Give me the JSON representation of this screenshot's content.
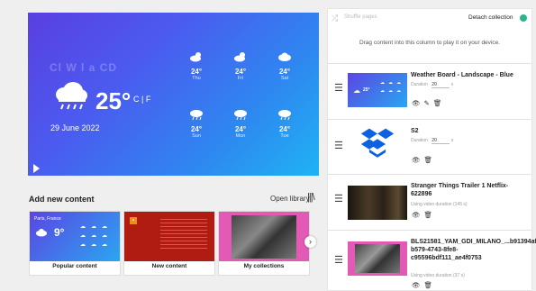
{
  "preview": {
    "faded_title": "Cl W  l  a  CD",
    "temperature": "25°",
    "unit_toggle": "C | F",
    "date": "29 June 2022",
    "forecast": [
      {
        "temp": "24°",
        "day": "Thu"
      },
      {
        "temp": "24°",
        "day": "Fri"
      },
      {
        "temp": "24°",
        "day": "Sat"
      },
      {
        "temp": "24°",
        "day": "Sun"
      },
      {
        "temp": "24°",
        "day": "Mon"
      },
      {
        "temp": "24°",
        "day": "Tue"
      }
    ]
  },
  "library": {
    "section_title": "Add new content",
    "open_library_label": "Open library",
    "cards": [
      {
        "label": "Popular content",
        "location": "Paris, France",
        "temp": "9°"
      },
      {
        "label": "New content"
      },
      {
        "label": "My collections"
      }
    ]
  },
  "collection": {
    "shuffle_label": "Shuffle pages",
    "detach_label": "Detach collection",
    "drop_hint": "Drag content into this column to play it on your device.",
    "items": [
      {
        "title": "Weather Board - Landscape - Blue",
        "meta_label": "Duration",
        "meta_value": "20",
        "meta_unit": "s"
      },
      {
        "title": "S2",
        "meta_label": "Duration",
        "meta_value": "20",
        "meta_unit": "s"
      },
      {
        "title": "Stranger Things Trailer 1 Netflix-622896",
        "meta_label": "Using video duration (145 s)"
      },
      {
        "title": "BLS21581_YAM_GDI_MILANO_...b91394af-b579-4743-8fe8-c95596bdf111_ae4f0753",
        "meta_label": "Using video duration (37 s)"
      }
    ]
  },
  "colors": {
    "accent": "#2bb58c",
    "preview_gradient_start": "#5a3fe0",
    "preview_gradient_end": "#1fb3f3"
  }
}
